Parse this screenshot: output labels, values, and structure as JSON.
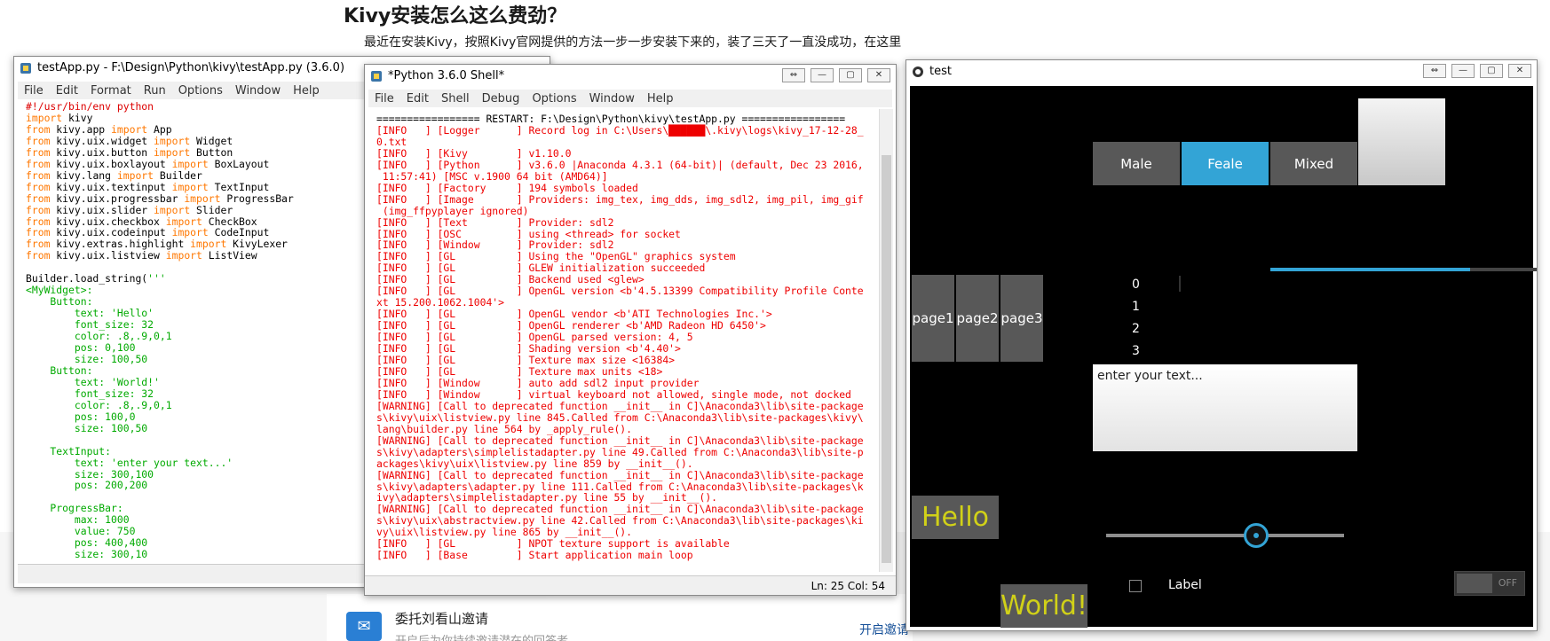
{
  "web": {
    "title": "Kivy安装怎么这么费劲？",
    "text": "最近在安装Kivy，按照Kivy官网提供的方法一步一步安装下来的，装了三天了一直没成功，在这里",
    "card_title": "委托刘看山邀请",
    "card_sub": "开启后为你持续邀请潜在的回答者",
    "card_link": "开启邀请"
  },
  "editor": {
    "title": "testApp.py - F:\\Design\\Python\\kivy\\testApp.py (3.6.0)",
    "menu": [
      "File",
      "Edit",
      "Format",
      "Run",
      "Options",
      "Window",
      "Help"
    ],
    "lines": [
      [
        [
          "cm",
          "#!/usr/bin/env python"
        ]
      ],
      [
        [
          "kw",
          "import"
        ],
        [
          "df",
          " kivy"
        ]
      ],
      [
        [
          "kw",
          "from"
        ],
        [
          "df",
          " kivy.app "
        ],
        [
          "kw",
          "import"
        ],
        [
          "df",
          " App"
        ]
      ],
      [
        [
          "kw",
          "from"
        ],
        [
          "df",
          " kivy.uix.widget "
        ],
        [
          "kw",
          "import"
        ],
        [
          "df",
          " Widget"
        ]
      ],
      [
        [
          "kw",
          "from"
        ],
        [
          "df",
          " kivy.uix.button "
        ],
        [
          "kw",
          "import"
        ],
        [
          "df",
          " Button"
        ]
      ],
      [
        [
          "kw",
          "from"
        ],
        [
          "df",
          " kivy.uix.boxlayout "
        ],
        [
          "kw",
          "import"
        ],
        [
          "df",
          " BoxLayout"
        ]
      ],
      [
        [
          "kw",
          "from"
        ],
        [
          "df",
          " kivy.lang "
        ],
        [
          "kw",
          "import"
        ],
        [
          "df",
          " Builder"
        ]
      ],
      [
        [
          "kw",
          "from"
        ],
        [
          "df",
          " kivy.uix.textinput "
        ],
        [
          "kw",
          "import"
        ],
        [
          "df",
          " TextInput"
        ]
      ],
      [
        [
          "kw",
          "from"
        ],
        [
          "df",
          " kivy.uix.progressbar "
        ],
        [
          "kw",
          "import"
        ],
        [
          "df",
          " ProgressBar"
        ]
      ],
      [
        [
          "kw",
          "from"
        ],
        [
          "df",
          " kivy.uix.slider "
        ],
        [
          "kw",
          "import"
        ],
        [
          "df",
          " Slider"
        ]
      ],
      [
        [
          "kw",
          "from"
        ],
        [
          "df",
          " kivy.uix.checkbox "
        ],
        [
          "kw",
          "import"
        ],
        [
          "df",
          " CheckBox"
        ]
      ],
      [
        [
          "kw",
          "from"
        ],
        [
          "df",
          " kivy.uix.codeinput "
        ],
        [
          "kw",
          "import"
        ],
        [
          "df",
          " CodeInput"
        ]
      ],
      [
        [
          "kw",
          "from"
        ],
        [
          "df",
          " kivy.extras.highlight "
        ],
        [
          "kw",
          "import"
        ],
        [
          "df",
          " KivyLexer"
        ]
      ],
      [
        [
          "kw",
          "from"
        ],
        [
          "df",
          " kivy.uix.listview "
        ],
        [
          "kw",
          "import"
        ],
        [
          "df",
          " ListView"
        ]
      ],
      [
        [
          "df",
          ""
        ]
      ],
      [
        [
          "df",
          "Builder.load_string("
        ],
        [
          "st",
          "'''"
        ]
      ],
      [
        [
          "st",
          "<MyWidget>:"
        ]
      ],
      [
        [
          "st",
          "    Button:"
        ]
      ],
      [
        [
          "st",
          "        text: 'Hello'"
        ]
      ],
      [
        [
          "st",
          "        font_size: 32"
        ]
      ],
      [
        [
          "st",
          "        color: .8,.9,0,1"
        ]
      ],
      [
        [
          "st",
          "        pos: 0,100"
        ]
      ],
      [
        [
          "st",
          "        size: 100,50"
        ]
      ],
      [
        [
          "st",
          "    Button:"
        ]
      ],
      [
        [
          "st",
          "        text: 'World!'"
        ]
      ],
      [
        [
          "st",
          "        font_size: 32"
        ]
      ],
      [
        [
          "st",
          "        color: .8,.9,0,1"
        ]
      ],
      [
        [
          "st",
          "        pos: 100,0"
        ]
      ],
      [
        [
          "st",
          "        size: 100,50"
        ]
      ],
      [
        [
          "st",
          ""
        ]
      ],
      [
        [
          "st",
          "    TextInput:"
        ]
      ],
      [
        [
          "st",
          "        text: 'enter your text...'"
        ]
      ],
      [
        [
          "st",
          "        size: 300,100"
        ]
      ],
      [
        [
          "st",
          "        pos: 200,200"
        ]
      ],
      [
        [
          "st",
          ""
        ]
      ],
      [
        [
          "st",
          "    ProgressBar:"
        ]
      ],
      [
        [
          "st",
          "        max: 1000"
        ]
      ],
      [
        [
          "st",
          "        value: 750"
        ]
      ],
      [
        [
          "st",
          "        pos: 400,400"
        ]
      ],
      [
        [
          "st",
          "        size: 300,10"
        ]
      ]
    ]
  },
  "shell": {
    "title": "*Python 3.6.0 Shell*",
    "menu": [
      "File",
      "Edit",
      "Shell",
      "Debug",
      "Options",
      "Window",
      "Help"
    ],
    "lines": [
      [
        "blk",
        "================= RESTART: F:\\Design\\Python\\kivy\\testApp.py ================="
      ],
      [
        "red",
        "[INFO   ] [Logger      ] Record log in C:\\Users\\██████\\.kivy\\logs\\kivy_17-12-28_"
      ],
      [
        "red",
        "0.txt"
      ],
      [
        "red",
        "[INFO   ] [Kivy        ] v1.10.0"
      ],
      [
        "red",
        "[INFO   ] [Python      ] v3.6.0 |Anaconda 4.3.1 (64-bit)| (default, Dec 23 2016,"
      ],
      [
        "red",
        " 11:57:41) [MSC v.1900 64 bit (AMD64)]"
      ],
      [
        "red",
        "[INFO   ] [Factory     ] 194 symbols loaded"
      ],
      [
        "red",
        "[INFO   ] [Image       ] Providers: img_tex, img_dds, img_sdl2, img_pil, img_gif"
      ],
      [
        "red",
        " (img_ffpyplayer ignored)"
      ],
      [
        "red",
        "[INFO   ] [Text        ] Provider: sdl2"
      ],
      [
        "red",
        "[INFO   ] [OSC         ] using <thread> for socket"
      ],
      [
        "red",
        "[INFO   ] [Window      ] Provider: sdl2"
      ],
      [
        "red",
        "[INFO   ] [GL          ] Using the \"OpenGL\" graphics system"
      ],
      [
        "red",
        "[INFO   ] [GL          ] GLEW initialization succeeded"
      ],
      [
        "red",
        "[INFO   ] [GL          ] Backend used <glew>"
      ],
      [
        "red",
        "[INFO   ] [GL          ] OpenGL version <b'4.5.13399 Compatibility Profile Conte"
      ],
      [
        "red",
        "xt 15.200.1062.1004'>"
      ],
      [
        "red",
        "[INFO   ] [GL          ] OpenGL vendor <b'ATI Technologies Inc.'>"
      ],
      [
        "red",
        "[INFO   ] [GL          ] OpenGL renderer <b'AMD Radeon HD 6450'>"
      ],
      [
        "red",
        "[INFO   ] [GL          ] OpenGL parsed version: 4, 5"
      ],
      [
        "red",
        "[INFO   ] [GL          ] Shading version <b'4.40'>"
      ],
      [
        "red",
        "[INFO   ] [GL          ] Texture max size <16384>"
      ],
      [
        "red",
        "[INFO   ] [GL          ] Texture max units <18>"
      ],
      [
        "red",
        "[INFO   ] [Window      ] auto add sdl2 input provider"
      ],
      [
        "red",
        "[INFO   ] [Window      ] virtual keyboard not allowed, single mode, not docked"
      ],
      [
        "red",
        "[WARNING] [Call to deprecated function __init__ in C]\\Anaconda3\\lib\\site-package"
      ],
      [
        "red",
        "s\\kivy\\uix\\listview.py line 845.Called from C:\\Anaconda3\\lib\\site-packages\\kivy\\"
      ],
      [
        "red",
        "lang\\builder.py line 564 by _apply_rule()."
      ],
      [
        "red",
        "[WARNING] [Call to deprecated function __init__ in C]\\Anaconda3\\lib\\site-package"
      ],
      [
        "red",
        "s\\kivy\\adapters\\simplelistadapter.py line 49.Called from C:\\Anaconda3\\lib\\site-p"
      ],
      [
        "red",
        "ackages\\kivy\\uix\\listview.py line 859 by __init__()."
      ],
      [
        "red",
        "[WARNING] [Call to deprecated function __init__ in C]\\Anaconda3\\lib\\site-package"
      ],
      [
        "red",
        "s\\kivy\\adapters\\adapter.py line 111.Called from C:\\Anaconda3\\lib\\site-packages\\k"
      ],
      [
        "red",
        "ivy\\adapters\\simplelistadapter.py line 55 by __init__()."
      ],
      [
        "red",
        "[WARNING] [Call to deprecated function __init__ in C]\\Anaconda3\\lib\\site-package"
      ],
      [
        "red",
        "s\\kivy\\uix\\abstractview.py line 42.Called from C:\\Anaconda3\\lib\\site-packages\\ki"
      ],
      [
        "red",
        "vy\\uix\\listview.py line 865 by __init__()."
      ],
      [
        "red",
        "[INFO   ] [GL          ] NPOT texture support is available"
      ],
      [
        "red",
        "[INFO   ] [Base        ] Start application main loop"
      ]
    ],
    "status": "Ln: 25   Col: 54"
  },
  "kivy": {
    "title": "test",
    "toggle": [
      "Male",
      "Feale",
      "Mixed"
    ],
    "pages": [
      "page1",
      "page2",
      "page3"
    ],
    "list": [
      "0",
      "1",
      "2",
      "3"
    ],
    "text_input": "enter your text...",
    "hello": "Hello",
    "world": "World!",
    "label": "Label",
    "switch": "OFF",
    "progress": 0.75,
    "slider": 0.63
  },
  "colors": {
    "accent": "#33a4d6",
    "button_text": "#d1d118",
    "keyword": "#ff7700",
    "string": "#00aa00",
    "log": "#ee0000"
  }
}
